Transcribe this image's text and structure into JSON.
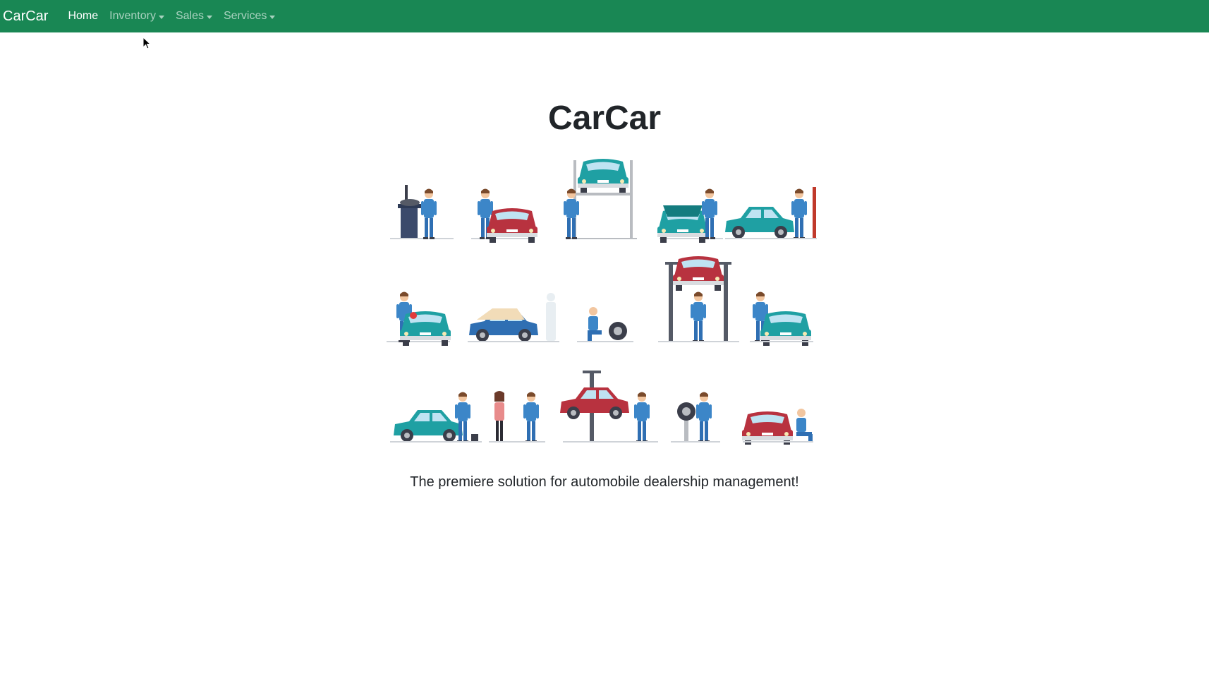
{
  "navbar": {
    "brand": "CarCar",
    "items": [
      {
        "label": "Home",
        "active": true,
        "dropdown": false
      },
      {
        "label": "Inventory",
        "active": false,
        "dropdown": true
      },
      {
        "label": "Sales",
        "active": false,
        "dropdown": true
      },
      {
        "label": "Services",
        "active": false,
        "dropdown": true
      }
    ],
    "background_color": "#198754"
  },
  "main": {
    "title": "CarCar",
    "tagline": "The premiere solution for automobile dealership management!"
  },
  "illustration": {
    "icon": "mechanics-illustration",
    "colors": {
      "teal": "#1fa0a3",
      "red": "#b8323f",
      "blue": "#2f6fb3",
      "worker": "#3c86c8",
      "metal": "#b9bcc1",
      "dark": "#3b3e4a"
    }
  }
}
